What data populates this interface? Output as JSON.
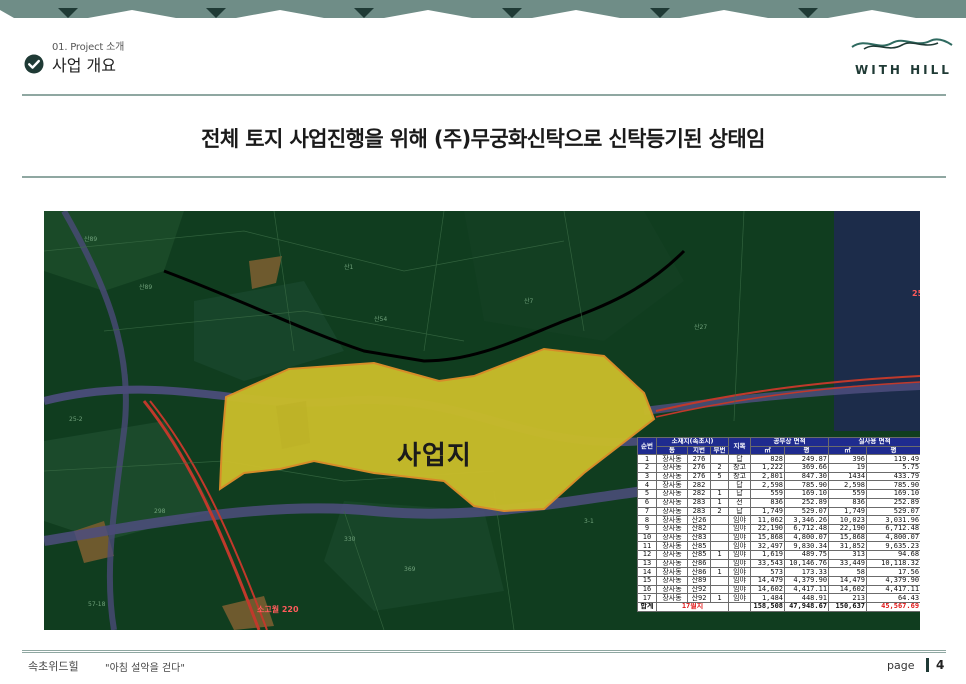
{
  "section": {
    "subtitle": "01. Project 소개",
    "title": "사업 개요"
  },
  "brand": {
    "logo_text": "WITH HILL",
    "colors": {
      "primary": "#1f3a35",
      "accent_band": "#5f7e78",
      "rule": "#8fa7a1"
    }
  },
  "headline": "전체 토지 사업진행을 위해 (주)무궁화신탁으로 신탁등기된 상태임",
  "map": {
    "site_label": "사업지",
    "road_label": "소고월 220",
    "road_label_2": "25"
  },
  "parcel_table": {
    "header_row1": {
      "seq": "순번",
      "location": "소재지(속초시)",
      "category": "지목",
      "official_area": "공부상 면적",
      "actual_area": "실사용 면적"
    },
    "header_row2": {
      "dong": "동",
      "main_lot": "지번",
      "sub_lot": "부번",
      "official_m2": "㎡",
      "official_py": "평",
      "actual_m2": "㎡",
      "actual_py": "평"
    },
    "rows": [
      [
        "1",
        "장사동",
        "276",
        "",
        "답",
        "828",
        "249.87",
        "396",
        "119.49"
      ],
      [
        "2",
        "장사동",
        "276",
        "2",
        "창고",
        "1,222",
        "369.66",
        "19",
        "5.75"
      ],
      [
        "3",
        "장사동",
        "276",
        "5",
        "창고",
        "2,801",
        "847.30",
        "1434",
        "433.79"
      ],
      [
        "4",
        "장사동",
        "282",
        "",
        "답",
        "2,598",
        "785.90",
        "2,598",
        "785.90"
      ],
      [
        "5",
        "장사동",
        "282",
        "1",
        "답",
        "559",
        "169.10",
        "559",
        "169.10"
      ],
      [
        "6",
        "장사동",
        "283",
        "1",
        "전",
        "836",
        "252.89",
        "836",
        "252.89"
      ],
      [
        "7",
        "장사동",
        "283",
        "2",
        "답",
        "1,749",
        "529.07",
        "1,749",
        "529.07"
      ],
      [
        "8",
        "장사동",
        "산26",
        "",
        "임야",
        "11,062",
        "3,346.26",
        "10,023",
        "3,031.96"
      ],
      [
        "9",
        "장사동",
        "산82",
        "",
        "임야",
        "22,190",
        "6,712.48",
        "22,190",
        "6,712.48"
      ],
      [
        "10",
        "장사동",
        "산83",
        "",
        "임야",
        "15,868",
        "4,800.07",
        "15,868",
        "4,800.07"
      ],
      [
        "11",
        "장사동",
        "산85",
        "",
        "임야",
        "32,497",
        "9,830.34",
        "31,852",
        "9,635.23"
      ],
      [
        "12",
        "장사동",
        "산85",
        "1",
        "임야",
        "1,619",
        "489.75",
        "313",
        "94.68"
      ],
      [
        "13",
        "장사동",
        "산86",
        "",
        "임야",
        "33,543",
        "10,146.76",
        "33,449",
        "10,118.32"
      ],
      [
        "14",
        "장사동",
        "산86",
        "1",
        "임야",
        "573",
        "173.33",
        "58",
        "17.56"
      ],
      [
        "15",
        "장사동",
        "산89",
        "",
        "임야",
        "14,479",
        "4,379.90",
        "14,479",
        "4,379.90"
      ],
      [
        "16",
        "장사동",
        "산92",
        "",
        "임야",
        "14,602",
        "4,417.11",
        "14,602",
        "4,417.11"
      ],
      [
        "17",
        "장사동",
        "산92",
        "1",
        "임야",
        "1,484",
        "448.91",
        "213",
        "64.43"
      ]
    ],
    "total": {
      "label": "합계",
      "parcels": "17필지",
      "official_m2": "158,508",
      "official_py": "47,948.67",
      "actual_m2": "150,637",
      "actual_py": "45,567.69"
    }
  },
  "footer": {
    "company": "속초위드힐",
    "slogan": "\"아침 설악을 걷다\"",
    "page_label": "page",
    "page_number": "4"
  }
}
